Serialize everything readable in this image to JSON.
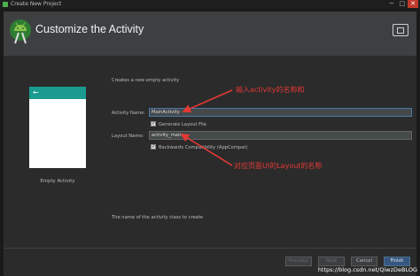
{
  "window": {
    "title": "Create New Project",
    "controls": {
      "minimize": "─",
      "maximize": "□",
      "close": "✕"
    }
  },
  "header": {
    "title": "Customize the Activity",
    "logo_icon": "android-studio-icon",
    "device_icon": "device-tablet-icon"
  },
  "template": {
    "name": "Empty Activity",
    "back_glyph": "←",
    "toolbar_color": "#1b9b8f"
  },
  "form": {
    "description": "Creates a new empty activity",
    "activity_name": {
      "label": "Activity Name:",
      "value": "MainActivity"
    },
    "generate_layout": {
      "label": "Generate Layout File",
      "checked": true
    },
    "layout_name": {
      "label": "Layout Name:",
      "value": "activity_main"
    },
    "backwards_compat": {
      "label": "Backwards Compatibility (AppCompat)",
      "checked": true
    },
    "check_glyph": "✓",
    "help": "The name of the activity class to create"
  },
  "buttons": {
    "previous": "Previous",
    "next": "Next",
    "cancel": "Cancel",
    "finish": "Finish"
  },
  "annotations": {
    "top": "输入activity的名称和",
    "bottom": "对应页面UI的Layout的名称"
  },
  "watermark": "https://blog.csdn.net/QiwzDeBLOG",
  "colors": {
    "accent": "#365880",
    "annotation": "#e53935",
    "background": "#2b2b2b",
    "header": "#3d3f41"
  }
}
